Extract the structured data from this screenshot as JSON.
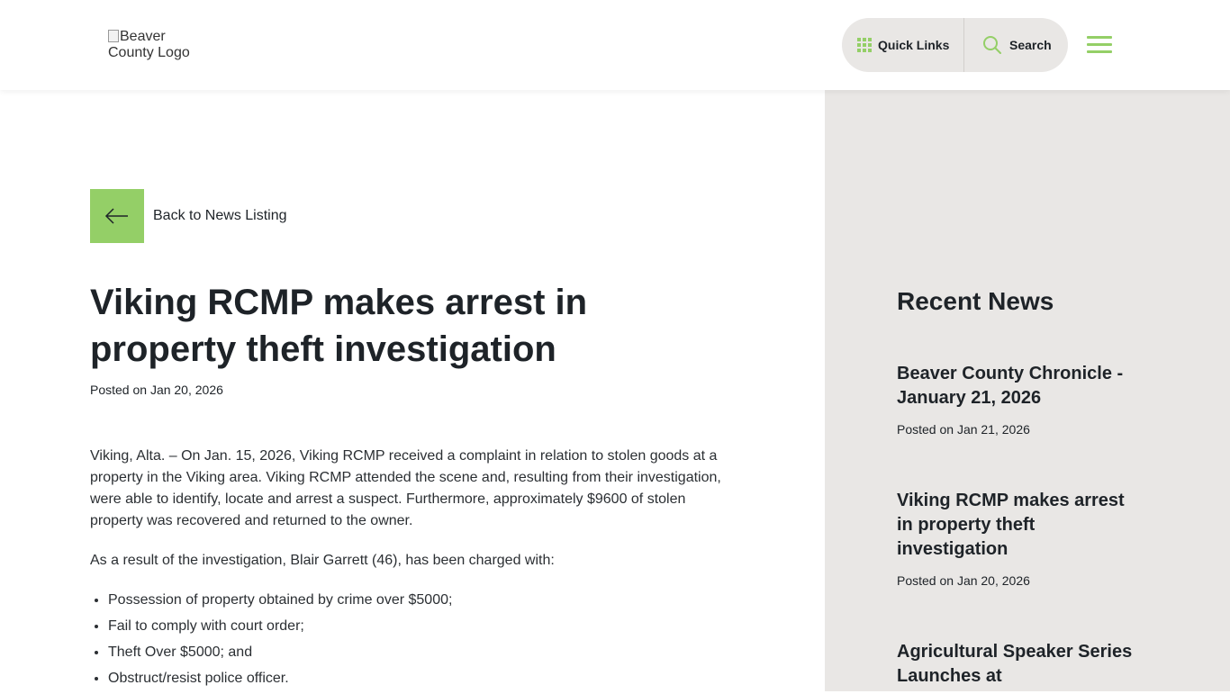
{
  "header": {
    "logo_alt": "Beaver County Logo",
    "quick_links_label": "Quick Links",
    "search_label": "Search"
  },
  "article": {
    "back_label": "Back to News Listing",
    "title": "Viking RCMP makes arrest in property theft investigation",
    "posted": "Posted on Jan 20, 2026",
    "paragraphs": [
      "Viking, Alta. – On Jan. 15, 2026, Viking RCMP received a complaint in relation to stolen goods at a property in the Viking area. Viking RCMP attended the scene and, resulting from their investigation, were able to identify, locate and arrest a suspect. Furthermore, approximately $9600 of stolen property was recovered and returned to the owner.",
      "As a result of the investigation, Blair Garrett (46), has been charged with:"
    ],
    "charges": [
      "Possession of property obtained by crime over $5000;",
      "Fail to comply with court order;",
      "Theft Over $5000; and",
      "Obstruct/resist police officer."
    ]
  },
  "sidebar": {
    "title": "Recent News",
    "items": [
      {
        "title": "Beaver County Chronicle - January 21, 2026",
        "posted": "Posted on Jan 21, 2026"
      },
      {
        "title": "Viking RCMP makes arrest in property theft investigation",
        "posted": "Posted on Jan 20, 2026"
      },
      {
        "title": "Agricultural Speaker Series Launches at",
        "posted": ""
      }
    ]
  },
  "colors": {
    "accent_green": "#94cf67",
    "pill_bg": "#e9e7e5",
    "sidebar_bg": "#e9e7e5",
    "text": "#1e2328"
  },
  "icons": [
    "grid-icon",
    "search-icon",
    "hamburger-menu-icon",
    "arrow-left-icon"
  ]
}
